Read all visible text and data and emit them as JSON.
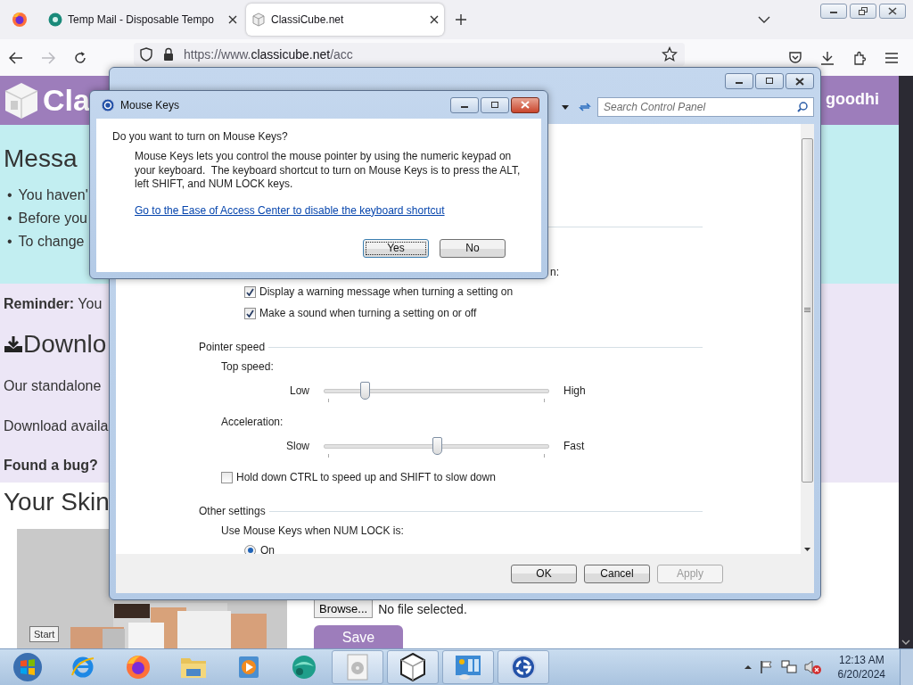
{
  "browser": {
    "tabs": [
      {
        "title": "Temp Mail - Disposable Tempo",
        "selected": false
      },
      {
        "title": "ClassiCube.net",
        "selected": true
      }
    ],
    "nav": {
      "forward_disabled": true
    },
    "address": {
      "scheme": "https://www.",
      "domain": "classicube.net",
      "path": "/acc"
    }
  },
  "page": {
    "logo_text": "Cla",
    "user": "goodhi",
    "messages": {
      "heading": "Messa",
      "bullet": "•",
      "items": [
        "You haven'",
        "Before you",
        "To change"
      ]
    },
    "reminder": "**Reminder:** You",
    "download": {
      "heading": "Downlo",
      "lines": [
        "Our standalone",
        "Download availa"
      ]
    },
    "bug": "**Found a bug?**",
    "skin": {
      "heading": "Your Skin",
      "browse": "Browse...",
      "file_status": "No file selected.",
      "save": "Save"
    }
  },
  "control_panel": {
    "search": {
      "placeholder": "Search Control Panel"
    },
    "partial_label": "n:",
    "notifications": [
      {
        "label": "Display a warning message when turning a setting on",
        "checked": true
      },
      {
        "label": "Make a sound when turning a setting on or off",
        "checked": true
      }
    ],
    "pointer_speed": {
      "title": "Pointer speed",
      "sliders": [
        {
          "label": "Top speed:",
          "min_label": "Low",
          "max_label": "High",
          "level": 0.18
        },
        {
          "label": "Acceleration:",
          "min_label": "Slow",
          "max_label": "Fast",
          "level": 0.5
        }
      ],
      "ctrl_shift": {
        "label": "Hold down CTRL to speed up and SHIFT to slow down",
        "checked": false
      }
    },
    "other": {
      "title": "Other settings",
      "num_lock_label": "Use Mouse Keys when NUM LOCK is:",
      "options": [
        {
          "label": "On",
          "selected": true
        }
      ]
    },
    "buttons": [
      {
        "label": "OK",
        "disabled": false
      },
      {
        "label": "Cancel",
        "disabled": false
      },
      {
        "label": "Apply",
        "disabled": true
      }
    ]
  },
  "dialog": {
    "title": "Mouse Keys",
    "question": "Do you want to turn on Mouse Keys?",
    "description": "Mouse Keys lets you control the mouse pointer by using the numeric keypad on your keyboard.  The keyboard shortcut to turn on Mouse Keys is to press the ALT, left SHIFT, and NUM LOCK keys.",
    "link": "Go to the Ease of Access Center to disable the keyboard shortcut",
    "buttons": [
      {
        "label": "Yes",
        "focused": true
      },
      {
        "label": "No",
        "focused": false
      }
    ]
  },
  "taskbar": {
    "tooltip": "Start",
    "time": "12:13 AM",
    "date": "6/20/2024"
  }
}
